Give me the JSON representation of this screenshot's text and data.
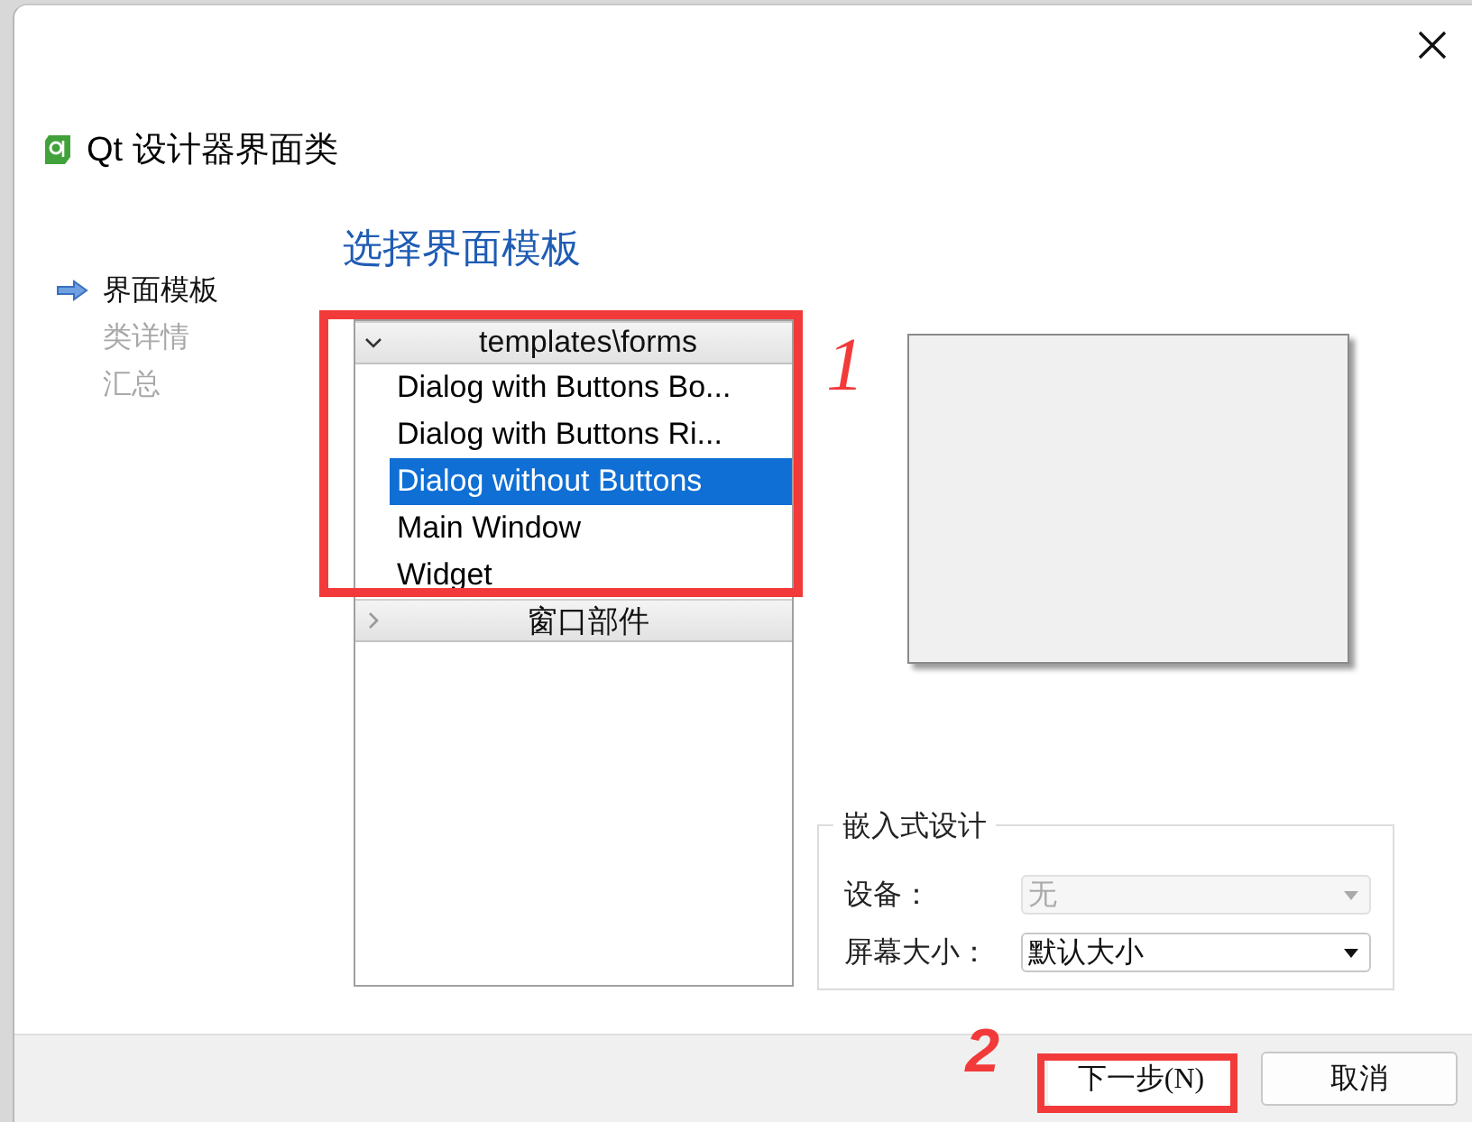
{
  "window": {
    "title": "Qt 设计器界面类"
  },
  "steps": [
    {
      "label": "界面模板",
      "selected": true
    },
    {
      "label": "类详情",
      "selected": false
    },
    {
      "label": "汇总",
      "selected": false
    }
  ],
  "heading": "选择界面模板",
  "tree": [
    {
      "label": "templates\\forms",
      "expanded": true,
      "children": [
        {
          "label": "Dialog with Buttons Bo...",
          "selected": false
        },
        {
          "label": "Dialog with Buttons Ri...",
          "selected": false
        },
        {
          "label": "Dialog without Buttons",
          "selected": true
        },
        {
          "label": "Main Window",
          "selected": false
        },
        {
          "label": "Widget",
          "selected": false
        }
      ]
    },
    {
      "label": "窗口部件",
      "expanded": false
    }
  ],
  "embedded": {
    "title": "嵌入式设计",
    "fields": [
      {
        "label": "设备：",
        "value": "无",
        "disabled": true
      },
      {
        "label": "屏幕大小：",
        "value": "默认大小",
        "disabled": false
      }
    ]
  },
  "buttons": [
    {
      "label": "下一步(N)",
      "kind": "next"
    },
    {
      "label": "取消",
      "kind": "cancel"
    }
  ],
  "annotations": [
    {
      "label": "1"
    },
    {
      "label": "2"
    }
  ]
}
